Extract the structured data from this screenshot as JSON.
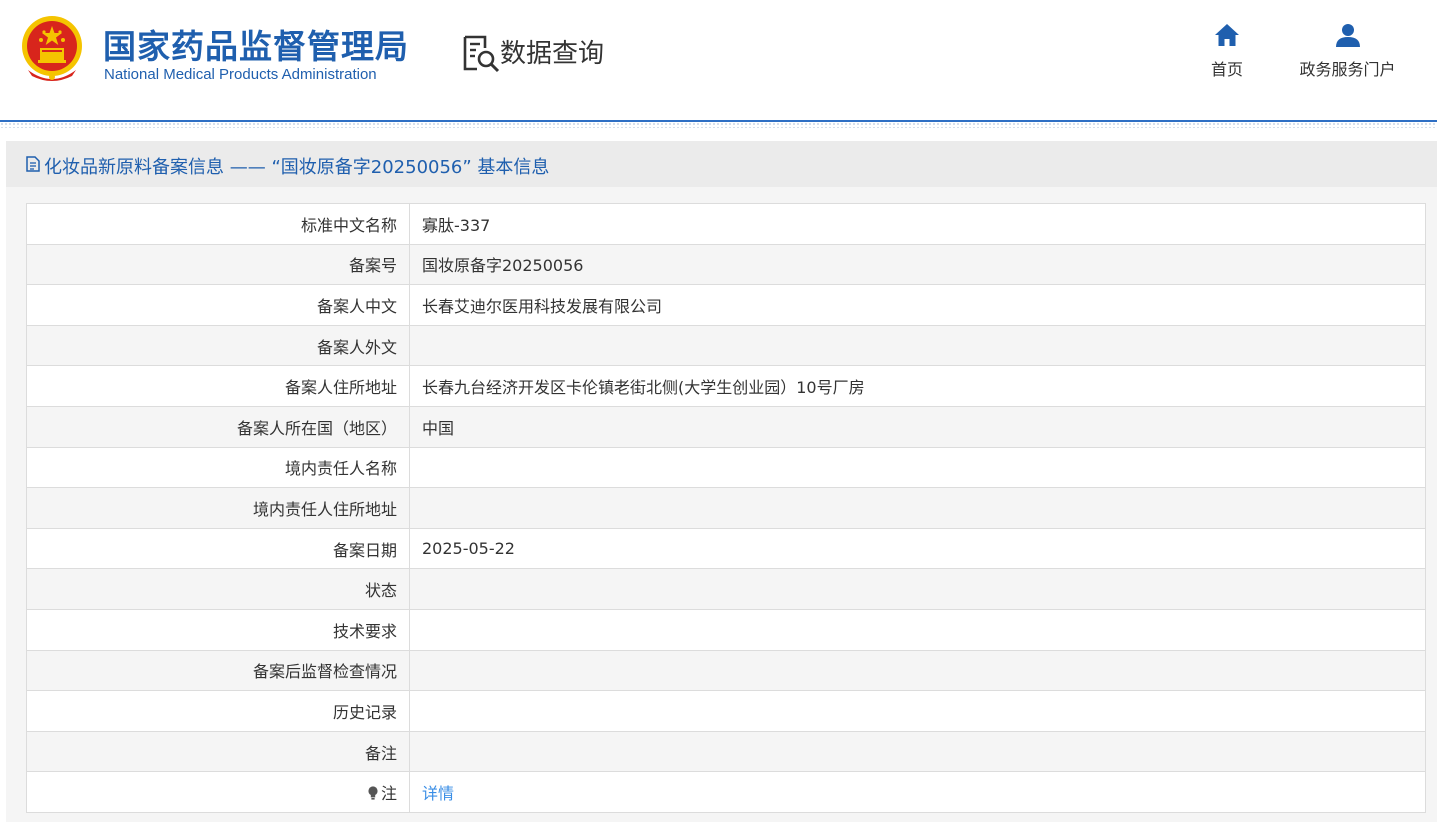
{
  "header": {
    "brand_cn": "国家药品监督管理局",
    "brand_en": "National Medical Products Administration",
    "section_title": "数据查询",
    "nav": [
      {
        "label": "首页",
        "icon": "home-icon"
      },
      {
        "label": "政务服务门户",
        "icon": "user-icon"
      }
    ]
  },
  "title_bar": {
    "icon": "document-icon",
    "text": "化妆品新原料备案信息 —— “国妆原备字20250056” 基本信息"
  },
  "colors": {
    "brand_blue": "#1f5fae",
    "link_blue": "#3a8ee6",
    "emblem_red": "#d8251c",
    "emblem_gold": "#f5c400"
  },
  "rows": [
    {
      "label": "标准中文名称",
      "value": "寡肽-337"
    },
    {
      "label": "备案号",
      "value": "国妆原备字20250056"
    },
    {
      "label": "备案人中文",
      "value": "长春艾迪尔医用科技发展有限公司"
    },
    {
      "label": "备案人外文",
      "value": ""
    },
    {
      "label": "备案人住所地址",
      "value": "长春九台经济开发区卡伦镇老街北侧(大学生创业园）10号厂房"
    },
    {
      "label": "备案人所在国（地区）",
      "value": "中国"
    },
    {
      "label": "境内责任人名称",
      "value": ""
    },
    {
      "label": "境内责任人住所地址",
      "value": ""
    },
    {
      "label": "备案日期",
      "value": "2025-05-22"
    },
    {
      "label": "状态",
      "value": ""
    },
    {
      "label": "技术要求",
      "value": ""
    },
    {
      "label": "备案后监督检查情况",
      "value": ""
    },
    {
      "label": "历史记录",
      "value": ""
    },
    {
      "label": "备注",
      "value": ""
    }
  ],
  "note_row": {
    "label": "注",
    "icon": "lightbulb-icon",
    "link": "详情"
  }
}
